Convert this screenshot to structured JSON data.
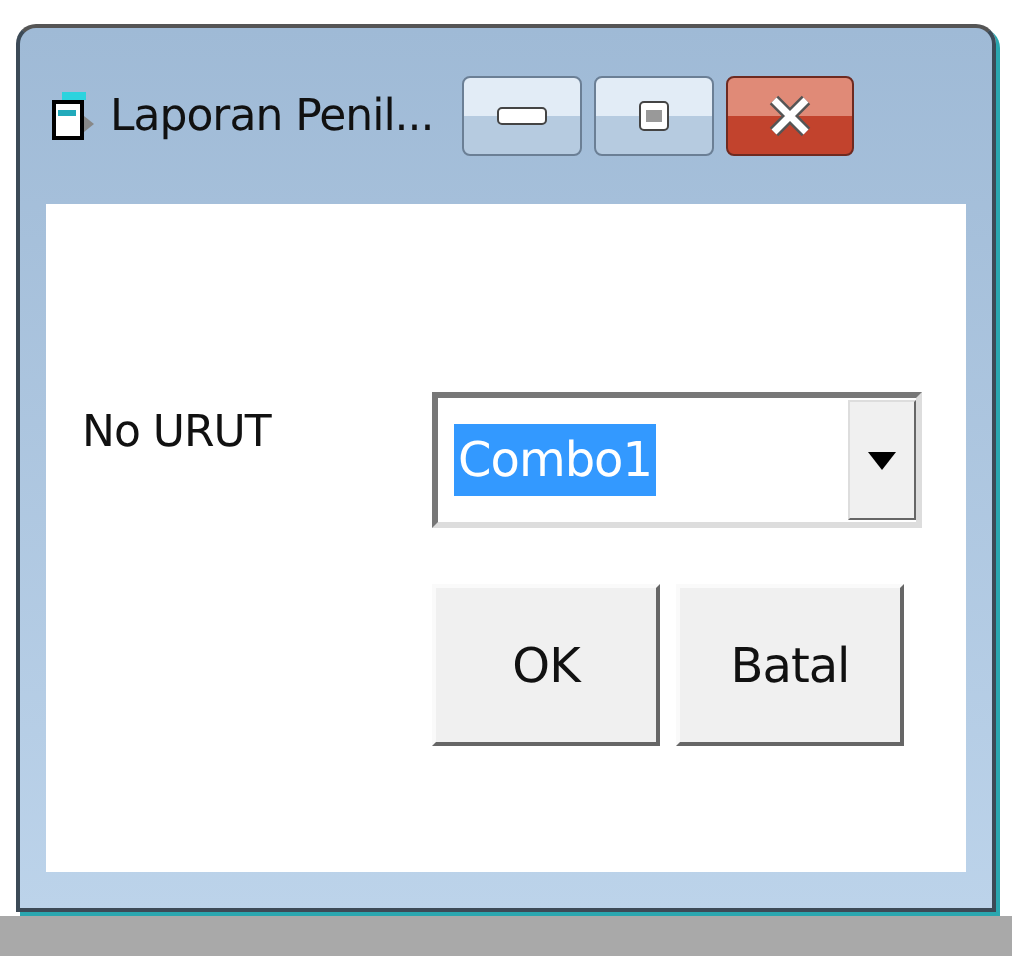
{
  "window": {
    "title": "Laporan Penil..."
  },
  "label": "No URUT",
  "combo": {
    "value": "Combo1",
    "selected_text": true
  },
  "buttons": [
    {
      "label": "OK"
    },
    {
      "label": "Batal"
    }
  ]
}
